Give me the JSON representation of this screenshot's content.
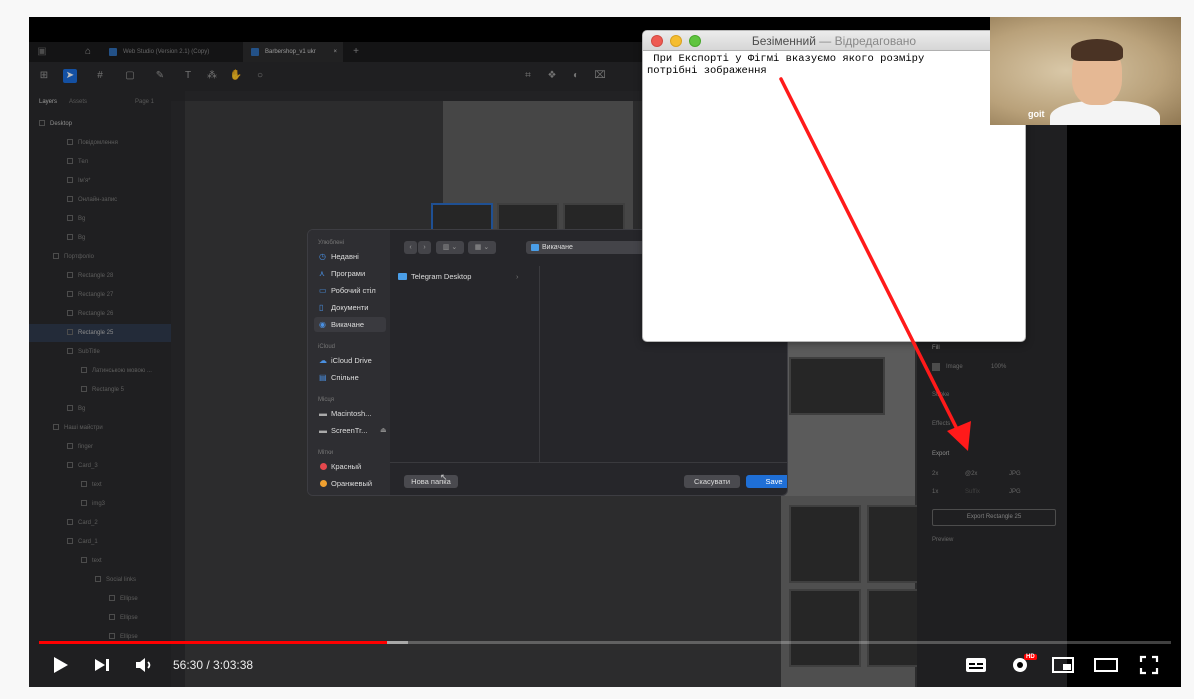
{
  "figma": {
    "tabs": [
      {
        "label": "Web Studio (Version 2.1) (Copy)"
      },
      {
        "label": "Barbershop_v1 ukr"
      }
    ],
    "panel_tabs": {
      "layers": "Layers",
      "assets": "Assets",
      "page": "Page 1"
    },
    "layers": [
      {
        "label": "Desktop",
        "indent": 0,
        "style": "bold"
      },
      {
        "label": "Повідомлення",
        "indent": 2
      },
      {
        "label": "Тел",
        "indent": 2
      },
      {
        "label": "Ім'я*",
        "indent": 2
      },
      {
        "label": "Онлайн-запис",
        "indent": 2
      },
      {
        "label": "Bg",
        "indent": 2
      },
      {
        "label": "Bg",
        "indent": 2
      },
      {
        "label": "Портфоліо",
        "indent": 1
      },
      {
        "label": "Rectangle 28",
        "indent": 2
      },
      {
        "label": "Rectangle 27",
        "indent": 2
      },
      {
        "label": "Rectangle 26",
        "indent": 2
      },
      {
        "label": "Rectangle 25",
        "indent": 2,
        "style": "sel"
      },
      {
        "label": "SubTitle",
        "indent": 2
      },
      {
        "label": "Латинською мовою ...",
        "indent": 3
      },
      {
        "label": "Rectangle 5",
        "indent": 3
      },
      {
        "label": "Bg",
        "indent": 2
      },
      {
        "label": "Наші майстри",
        "indent": 1
      },
      {
        "label": "finger",
        "indent": 2
      },
      {
        "label": "Card_3",
        "indent": 2
      },
      {
        "label": "text",
        "indent": 3
      },
      {
        "label": "img3",
        "indent": 3
      },
      {
        "label": "Card_2",
        "indent": 2
      },
      {
        "label": "Card_1",
        "indent": 2
      },
      {
        "label": "text",
        "indent": 3
      },
      {
        "label": "Social links",
        "indent": 4
      },
      {
        "label": "Ellipse",
        "indent": 5
      },
      {
        "label": "Ellipse",
        "indent": 5
      },
      {
        "label": "Ellipse",
        "indent": 5
      }
    ],
    "right_panel": {
      "fill_label": "Fill",
      "fill_type": "Image",
      "fill_opacity": "100%",
      "stroke_label": "Stroke",
      "effects_label": "Effects",
      "export_label": "Export",
      "export_rows": [
        {
          "scale": "2x",
          "suffix": "@2x",
          "format": "JPG"
        },
        {
          "scale": "1x",
          "suffix": "Suffix",
          "format": "JPG"
        }
      ],
      "export_button": "Export Rectangle 25",
      "preview_label": "Preview"
    }
  },
  "dialog": {
    "sidebar": {
      "favorites_heading": "Улюблені",
      "favorites": [
        {
          "label": "Недавні",
          "icon": "clock-icon"
        },
        {
          "label": "Програми",
          "icon": "apps-icon"
        },
        {
          "label": "Робочий стіл",
          "icon": "desktop-icon"
        },
        {
          "label": "Документи",
          "icon": "document-icon"
        },
        {
          "label": "Викачане",
          "icon": "download-icon"
        }
      ],
      "icloud_heading": "iCloud",
      "icloud": [
        {
          "label": "iCloud Drive",
          "icon": "cloud-icon"
        },
        {
          "label": "Спільне",
          "icon": "shared-folder-icon"
        }
      ],
      "locations_heading": "Місця",
      "locations": [
        {
          "label": "Macintosh...",
          "icon": "disk-icon"
        },
        {
          "label": "ScreenTr...",
          "icon": "disk-icon"
        }
      ],
      "tags_heading": "Мітки",
      "tags": [
        {
          "label": "Красный",
          "color": "#e5484d"
        },
        {
          "label": "Оранжевый",
          "color": "#f0a030"
        }
      ]
    },
    "location": "Викачане",
    "files": [
      {
        "label": "Telegram Desktop"
      }
    ],
    "new_folder_button": "Нова папка",
    "cancel_button": "Скасувати",
    "save_button": "Save"
  },
  "textedit": {
    "title": "Безіменний",
    "title_status": "Відредаговано",
    "line1": " При Експорті у Фігмі вказуємо якого розміру",
    "line2": "потрібні зображення"
  },
  "webcam": {
    "watermark": "goit"
  },
  "player": {
    "time_current": "56:30",
    "time_total": "3:03:38",
    "progress": 0.3075,
    "hd_badge": "HD",
    "accent_color": "#ff0000"
  }
}
